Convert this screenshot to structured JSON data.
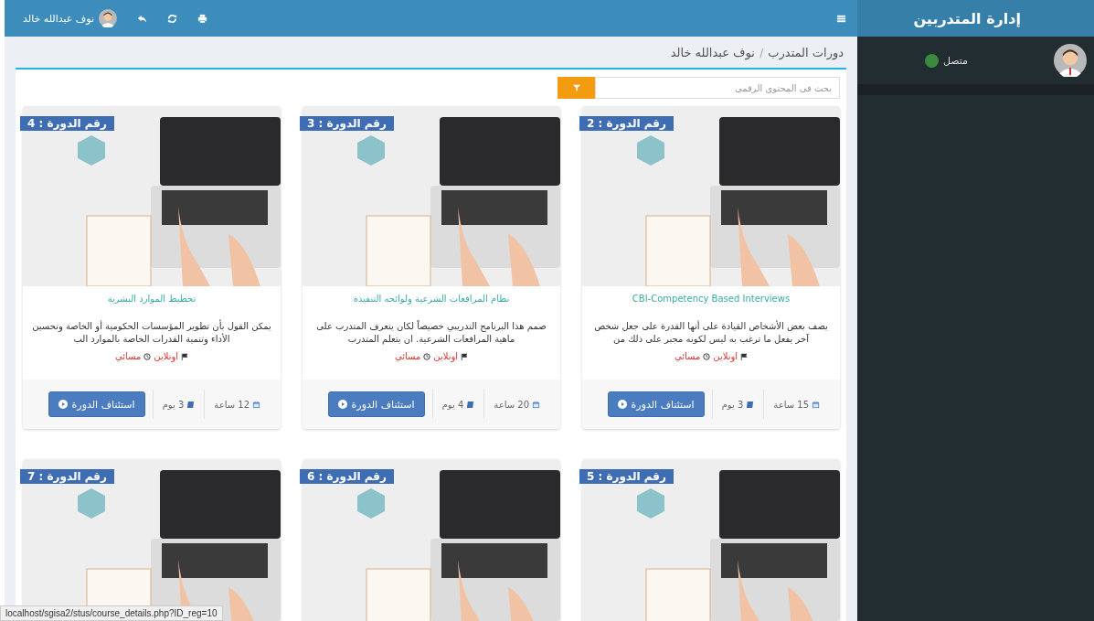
{
  "sidebar": {
    "title": "إدارة المتدربين",
    "user": {
      "status": "متصل",
      "online": true
    }
  },
  "topbar": {
    "user_name": "نوف عبدالله خالد"
  },
  "breadcrumb": {
    "section": "دورات المتدرب",
    "separator": "/",
    "current": "نوف عبدالله خالد"
  },
  "search": {
    "placeholder": "بحث في المحتوي الرقمي"
  },
  "courses": [
    {
      "badge": "رقم الدورة : 2",
      "title": "CBI-Competency Based Interviews",
      "description": "يصف بعض الأشخاص القيادة على أنها القدرة على جعل شخص آخر يفعل ما ترغب به ليس لكونه مجبر على ذلك من",
      "mode": "اونلاين",
      "time": "مسائي",
      "hours": "15 ساعة",
      "days": "3 يوم",
      "action": "استئناف الدورة"
    },
    {
      "badge": "رقم الدورة : 3",
      "title": "نظام المرافعات الشرعية ولوائحه التنفيذة",
      "description": "صمم هذا البرنامج التدريبي خصيصاً لكان يتعرف المتدرب على ماهية المرافعات الشرعية. ان يتعلم المتدرب",
      "mode": "اونلاين",
      "time": "مسائي",
      "hours": "20 ساعة",
      "days": "4 يوم",
      "action": "استئناف الدورة"
    },
    {
      "badge": "رقم الدورة : 4",
      "title": "تخطيط الموارد البشرية",
      "description": "يمكن القول بأن تطوير المؤسسات الحكومية أو الخاصة وتحسين الأداء وتنمية القدرات الخاصة بالموارد الب",
      "mode": "اونلاين",
      "time": "مسائي",
      "hours": "12 ساعة",
      "days": "3 يوم",
      "action": "استئناف الدورة"
    },
    {
      "badge": "رقم الدورة : 5"
    },
    {
      "badge": "رقم الدورة : 6"
    },
    {
      "badge": "رقم الدورة : 7"
    }
  ],
  "status_bar": "localhost/sgisa2/stus/course_details.php?ID_reg=10"
}
